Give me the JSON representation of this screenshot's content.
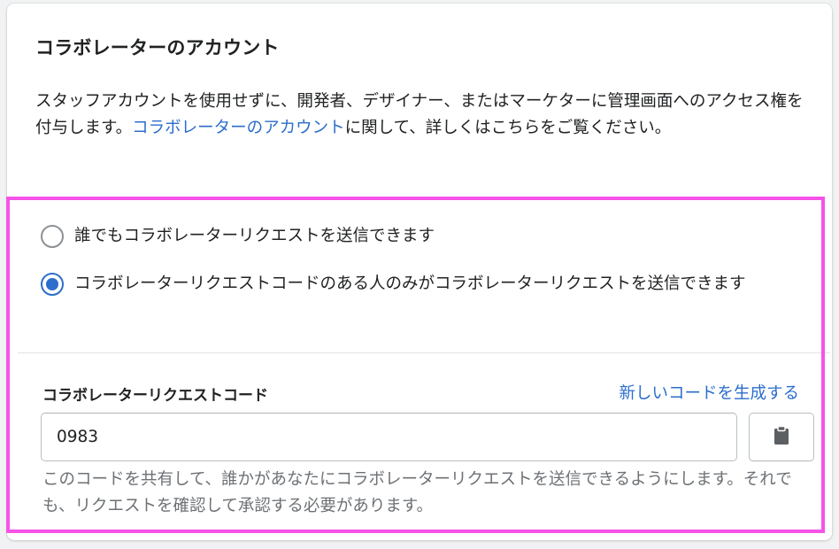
{
  "card": {
    "title": "コラボレーターのアカウント",
    "description_before": "スタッフアカウントを使用せずに、開発者、デザイナー、またはマーケターに管理画面へのアクセス権を付与します。",
    "description_link": "コラボレーターのアカウント",
    "description_after": "に関して、詳しくはこちらをご覧ください。"
  },
  "options": [
    {
      "label": "誰でもコラボレーターリクエストを送信できます",
      "selected": false
    },
    {
      "label": "コラボレーターリクエストコードのある人のみがコラボレーターリクエストを送信できます",
      "selected": true
    }
  ],
  "code_section": {
    "label": "コラボレーターリクエストコード",
    "generate_link": "新しいコードを生成する",
    "code_value": "0983",
    "copy_icon": "clipboard-icon",
    "help_text": "このコードを共有して、誰かがあなたにコラボレーターリクエストを送信できるようにします。それでも、リクエストを確認して承認する必要があります。"
  },
  "colors": {
    "link": "#2c6ecb",
    "highlight_border": "#f653e8",
    "radio_selected": "#2c6ecb"
  }
}
